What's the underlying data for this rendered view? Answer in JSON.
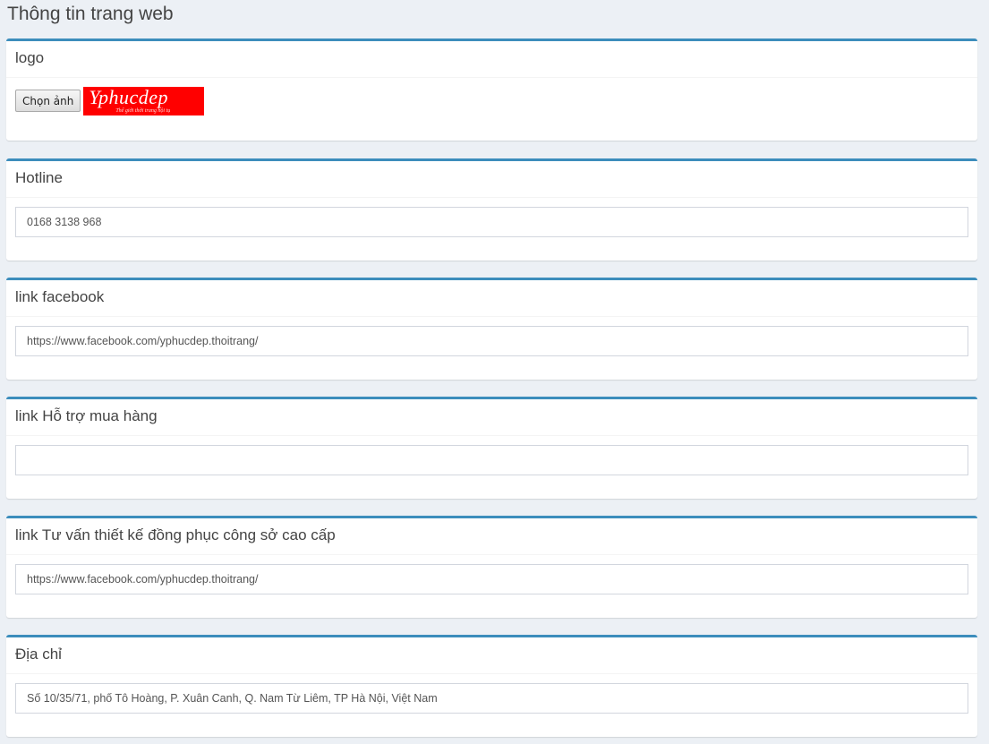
{
  "page": {
    "title": "Thông tin trang web"
  },
  "logo_section": {
    "label": "logo",
    "choose_button": "Chọn ảnh",
    "logo_text": "Yphucdep",
    "logo_tagline": "Thế giới thời trang hội tụ",
    "logo_bg": "#ff0000"
  },
  "fields": [
    {
      "label": "Hotline",
      "value": "0168 3138 968"
    },
    {
      "label": "link facebook",
      "value": "https://www.facebook.com/yphucdep.thoitrang/"
    },
    {
      "label": "link Hỗ trợ mua hàng",
      "value": ""
    },
    {
      "label": "link Tư vấn thiết kế đồng phục công sở cao cấp",
      "value": "https://www.facebook.com/yphucdep.thoitrang/"
    },
    {
      "label": "Địa chỉ",
      "value": "Số 10/35/71, phố Tô Hoàng, P. Xuân Canh, Q. Nam Từ Liêm, TP Hà Nội, Việt Nam"
    }
  ],
  "colors": {
    "accent": "#3c8dbc",
    "background": "#ecf0f5"
  }
}
